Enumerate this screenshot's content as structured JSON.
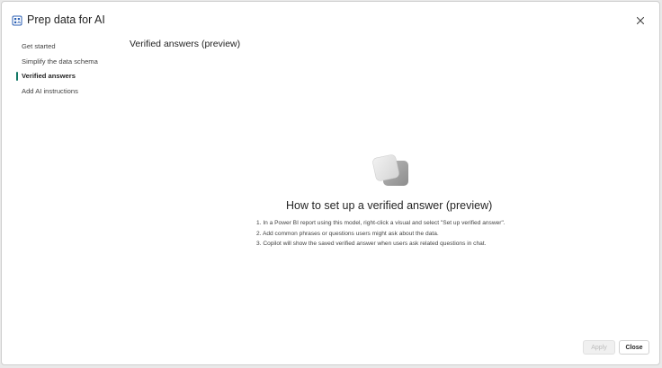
{
  "dialog": {
    "title": "Prep data for AI",
    "icon": "prep-data-icon",
    "close_icon": "close-icon"
  },
  "nav": {
    "items": [
      {
        "label": "Get started",
        "active": false
      },
      {
        "label": "Simplify the data schema",
        "active": false
      },
      {
        "label": "Verified answers",
        "active": true
      },
      {
        "label": "Add AI instructions",
        "active": false
      }
    ]
  },
  "main": {
    "section_title": "Verified answers (preview)",
    "illustration_icon": "stacked-cards-icon",
    "heading": "How to set up a verified answer (preview)",
    "steps": [
      "1. In a Power BI report using this model, right-click a visual and select \"Set up verified answer\".",
      "2. Add common phrases or questions users might ask about the data.",
      "3. Copilot will show the saved verified answer when users ask related questions in chat."
    ]
  },
  "footer": {
    "apply_label": "Apply",
    "close_label": "Close"
  },
  "colors": {
    "accent": "#117865",
    "disabled_text": "#bdbdbd"
  }
}
